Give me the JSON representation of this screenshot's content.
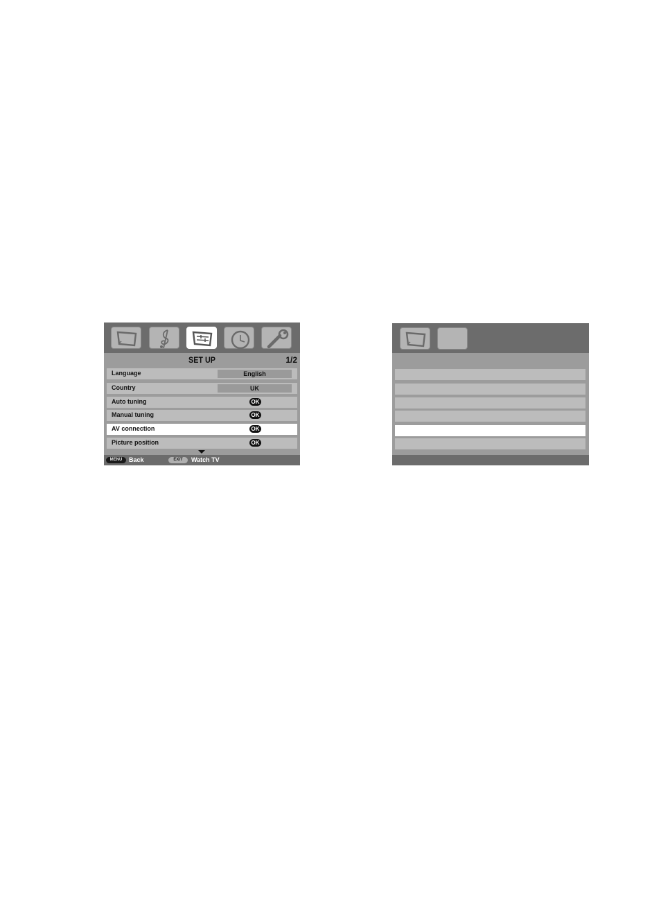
{
  "left_menu": {
    "title": "SET UP",
    "page_indicator": "1/2",
    "tabs": [
      {
        "icon": "tv-picture-icon",
        "active": false
      },
      {
        "icon": "music-note-icon",
        "active": false
      },
      {
        "icon": "setup-sliders-icon",
        "active": true
      },
      {
        "icon": "clock-icon",
        "active": false
      },
      {
        "icon": "wrench-icon",
        "active": false
      }
    ],
    "rows": [
      {
        "label": "Language",
        "value": "English"
      },
      {
        "label": "Country",
        "value": "UK"
      },
      {
        "label": "Auto tuning",
        "value": "OK"
      },
      {
        "label": "Manual tuning",
        "value": "OK"
      },
      {
        "label": "AV connection",
        "value": "OK"
      },
      {
        "label": "Picture position",
        "value": "OK"
      }
    ],
    "footer": {
      "menu_key": "MENU",
      "menu_label": "Back",
      "exit_key": "EXIT",
      "exit_label": "Watch TV"
    }
  },
  "right_menu": {
    "tabs": [
      {
        "icon": "tv-picture-icon"
      },
      {
        "icon": "blank-tab-icon"
      }
    ],
    "row_count": 6,
    "selected_row": 5
  }
}
